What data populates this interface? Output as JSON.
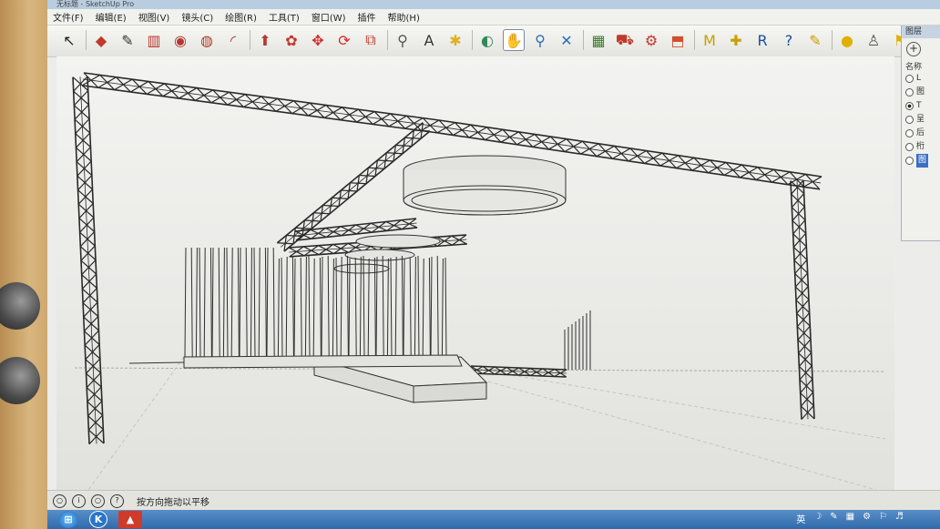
{
  "window": {
    "title": "无标题 - SketchUp Pro"
  },
  "menu": [
    "文件(F)",
    "编辑(E)",
    "视图(V)",
    "镜头(C)",
    "绘图(R)",
    "工具(T)",
    "窗口(W)",
    "插件",
    "帮助(H)"
  ],
  "toolbar": {
    "tools": [
      {
        "name": "select-tool-icon",
        "glyph": "↖",
        "color": "#222"
      },
      {
        "name": "eraser-tool-icon",
        "glyph": "◆",
        "color": "#c0392b"
      },
      {
        "name": "pencil-tool-icon",
        "glyph": "✎",
        "color": "#333"
      },
      {
        "name": "rectangle-tool-icon",
        "glyph": "▥",
        "color": "#b5392e"
      },
      {
        "name": "circle-tool-icon",
        "glyph": "◉",
        "color": "#b5392e"
      },
      {
        "name": "polygon-tool-icon",
        "glyph": "◍",
        "color": "#b5392e"
      },
      {
        "name": "arc-tool-icon",
        "glyph": "◜",
        "color": "#b5392e"
      },
      {
        "name": "push-pull-tool-icon",
        "glyph": "⬆",
        "color": "#b5392e"
      },
      {
        "name": "follow-me-tool-icon",
        "glyph": "✿",
        "color": "#c0392b"
      },
      {
        "name": "move-tool-icon",
        "glyph": "✥",
        "color": "#d12b2b"
      },
      {
        "name": "rotate-tool-icon",
        "glyph": "⟳",
        "color": "#d12b2b"
      },
      {
        "name": "scale-tool-icon",
        "glyph": "⧉",
        "color": "#c0392b"
      },
      {
        "name": "tape-measure-tool-icon",
        "glyph": "⚲",
        "color": "#555"
      },
      {
        "name": "text-tool-icon",
        "glyph": "A",
        "color": "#333"
      },
      {
        "name": "paint-bucket-tool-icon",
        "glyph": "✱",
        "color": "#e0b020"
      },
      {
        "name": "orbit-tool-icon",
        "glyph": "◐",
        "color": "#2e8b57"
      },
      {
        "name": "pan-tool-icon",
        "glyph": "✋",
        "color": "#444"
      },
      {
        "name": "zoom-tool-icon",
        "glyph": "⚲",
        "color": "#2a6fb5"
      },
      {
        "name": "zoom-extents-tool-icon",
        "glyph": "✕",
        "color": "#2a6fb5"
      },
      {
        "name": "get-models-icon",
        "glyph": "▦",
        "color": "#3b7d2b"
      },
      {
        "name": "share-model-icon",
        "glyph": "⛟",
        "color": "#c0392b"
      },
      {
        "name": "share-component-icon",
        "glyph": "⚙",
        "color": "#c0392b"
      },
      {
        "name": "extension-warehouse-icon",
        "glyph": "⬒",
        "color": "#d05030"
      },
      {
        "name": "plugin-m-icon",
        "glyph": "M",
        "color": "#c7a000"
      },
      {
        "name": "plugin-location-icon",
        "glyph": "✚",
        "color": "#c7a000"
      },
      {
        "name": "plugin-r-icon",
        "glyph": "R",
        "color": "#1d4fa0"
      },
      {
        "name": "help-icon",
        "glyph": "?",
        "color": "#1d4fa0"
      },
      {
        "name": "tag-icon",
        "glyph": "✎",
        "color": "#c7a000"
      },
      {
        "name": "sun-icon",
        "glyph": "●",
        "color": "#e0b000"
      },
      {
        "name": "user-icon",
        "glyph": "♙",
        "color": "#555"
      },
      {
        "name": "flag-icon",
        "glyph": "⚑",
        "color": "#e0b000"
      }
    ]
  },
  "tray": {
    "title": "图层",
    "column_header": "名称",
    "layers": [
      {
        "label": "L",
        "checked": false,
        "selected": false
      },
      {
        "label": "图",
        "checked": false,
        "selected": false
      },
      {
        "label": "T",
        "checked": true,
        "selected": false
      },
      {
        "label": "呈",
        "checked": false,
        "selected": false
      },
      {
        "label": "后",
        "checked": false,
        "selected": false
      },
      {
        "label": "桁",
        "checked": false,
        "selected": false
      },
      {
        "label": "图",
        "checked": false,
        "selected": true
      }
    ]
  },
  "status": {
    "text": "按方向拖动以平移"
  },
  "taskbar": {
    "tray": [
      "英",
      "☽",
      "✎",
      "▦",
      "⚙",
      "⚐",
      "♬"
    ]
  }
}
